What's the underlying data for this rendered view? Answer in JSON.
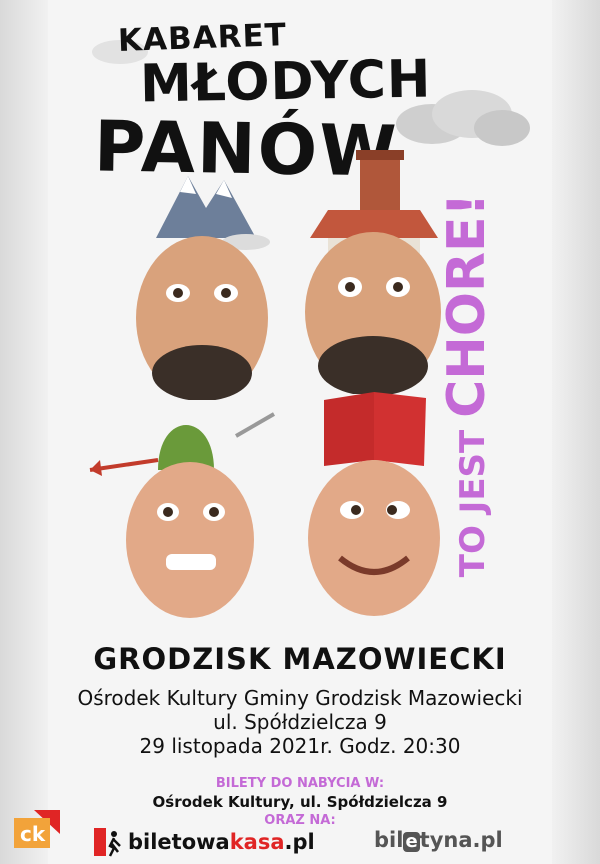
{
  "title": {
    "line1": "KABARET",
    "line2": "MŁODYCH",
    "line3": "PANÓW"
  },
  "slogan": {
    "prefix": "TO JEST ",
    "highlight": "CHORE!"
  },
  "event": {
    "city": "GRODZISK MAZOWIECKI",
    "venue": "Ośrodek Kultury Gminy Grodzisk Mazowiecki",
    "street": "ul. Spółdzielcza 9",
    "datetime": "29 listopada 2021r. Godz. 20:30"
  },
  "tickets": {
    "heading": "BILETY DO NABYCIA W:",
    "place": "Ośrodek Kultury, ul. Spółdzielcza 9",
    "also": "ORAZ NA:"
  },
  "logos": {
    "biletowa_part1": "biletowa",
    "biletowa_part2": "kasa",
    "biletowa_suffix": ".pl",
    "bilety_part1": "bil",
    "bilety_box": "e",
    "bilety_part2": "tyna.pl",
    "ck_text": "ck"
  },
  "colors": {
    "accent": "#c46ad6",
    "red": "#e02525",
    "orange": "#f2a33a"
  }
}
